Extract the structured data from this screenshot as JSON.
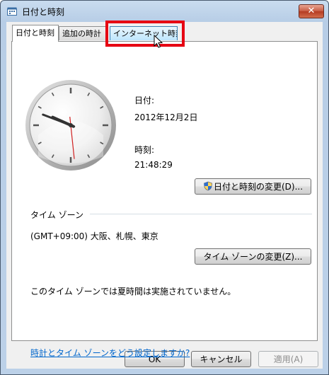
{
  "window": {
    "title": "日付と時刻",
    "close_label": "✕"
  },
  "tabs": [
    {
      "label": "日付と時刻"
    },
    {
      "label": "追加の時計"
    },
    {
      "label": "インターネット時刻"
    }
  ],
  "date_section": {
    "date_label": "日付:",
    "date_value": "2012年12月2日",
    "time_label": "時刻:",
    "time_value": "21:48:29",
    "change_button": "日付と時刻の変更(D)..."
  },
  "clock": {
    "hour": 21,
    "minute": 48,
    "second": 29
  },
  "timezone": {
    "header": "タイム ゾーン",
    "value": "(GMT+09:00) 大阪、札幌、東京",
    "change_button": "タイム ゾーンの変更(Z)...",
    "dst_note": "このタイム ゾーンでは夏時間は実施されていません。"
  },
  "help_link": "時計とタイム ゾーンをどう設定しますか?",
  "buttons": {
    "ok": "OK",
    "cancel": "キャンセル",
    "apply": "適用(A)"
  },
  "colors": {
    "highlight": "#e60012",
    "link": "#0066cc",
    "accent": "#3c7fb1"
  }
}
